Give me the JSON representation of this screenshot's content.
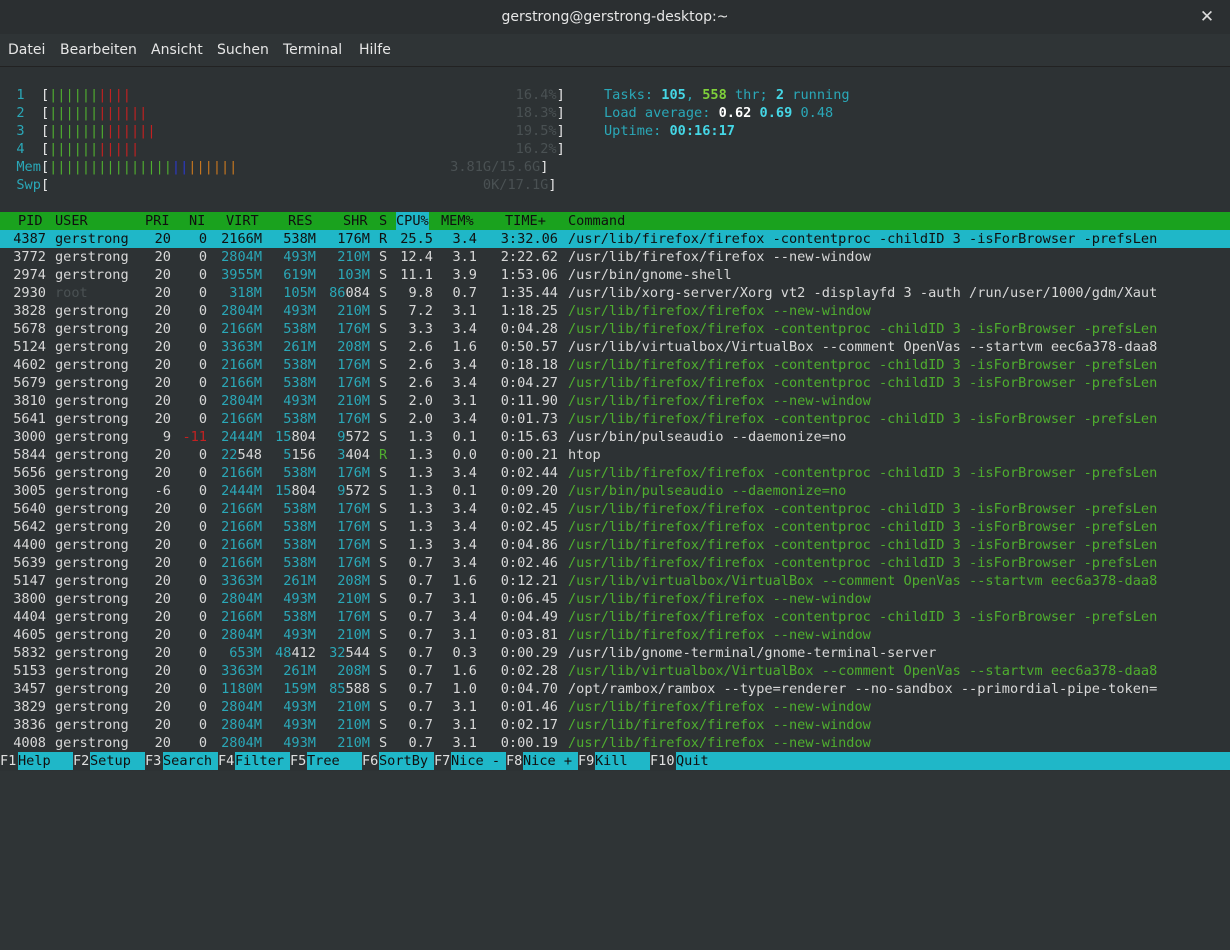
{
  "window": {
    "title": "gerstrong@gerstrong-desktop:~"
  },
  "menu": [
    "Datei",
    "Bearbeiten",
    "Ansicht",
    "Suchen",
    "Terminal",
    "Hilfe"
  ],
  "meters": {
    "cpu": [
      {
        "label": "1",
        "value": "16.4%"
      },
      {
        "label": "2",
        "value": "18.3%"
      },
      {
        "label": "3",
        "value": "19.5%"
      },
      {
        "label": "4",
        "value": "16.2%"
      }
    ],
    "mem": {
      "label": "Mem",
      "value": "3.81G/15.6G"
    },
    "swp": {
      "label": "Swp",
      "value": "0K/17.1G"
    }
  },
  "summary": {
    "tasks_label": "Tasks:",
    "tasks": "105",
    "threads": "558",
    "thr_label": "thr;",
    "running": "2",
    "running_label": "running",
    "load_label": "Load average:",
    "load1": "0.62",
    "load5": "0.69",
    "load15": "0.48",
    "uptime_label": "Uptime:",
    "uptime": "00:16:17"
  },
  "columns": [
    "PID",
    "USER",
    "PRI",
    "NI",
    "VIRT",
    "RES",
    "SHR",
    "S",
    "CPU%",
    "MEM%",
    "TIME+",
    "Command"
  ],
  "processes": [
    {
      "pid": "4387",
      "user": "gerstrong",
      "pri": "20",
      "ni": "0",
      "virt": "2166M",
      "res": "538M",
      "shr": "176M",
      "s": "R",
      "cpu": "25.5",
      "mem": "3.4",
      "time": "3:32.06",
      "cmd": "/usr/lib/firefox/firefox -contentproc -childID 3 -isForBrowser -prefsLen",
      "selected": true,
      "thread": false
    },
    {
      "pid": "3772",
      "user": "gerstrong",
      "pri": "20",
      "ni": "0",
      "virt": "2804M",
      "res": "493M",
      "shr": "210M",
      "s": "S",
      "cpu": "12.4",
      "mem": "3.1",
      "time": "2:22.62",
      "cmd": "/usr/lib/firefox/firefox --new-window",
      "selected": false,
      "thread": false
    },
    {
      "pid": "2974",
      "user": "gerstrong",
      "pri": "20",
      "ni": "0",
      "virt": "3955M",
      "res": "619M",
      "shr": "103M",
      "s": "S",
      "cpu": "11.1",
      "mem": "3.9",
      "time": "1:53.06",
      "cmd": "/usr/bin/gnome-shell",
      "selected": false,
      "thread": false
    },
    {
      "pid": "2930",
      "user": "root",
      "pri": "20",
      "ni": "0",
      "virt": "318M",
      "res": "105M",
      "shr": "86084",
      "s": "S",
      "cpu": "9.8",
      "mem": "0.7",
      "time": "1:35.44",
      "cmd": "/usr/lib/xorg-server/Xorg vt2 -displayfd 3 -auth /run/user/1000/gdm/Xaut",
      "selected": false,
      "thread": false
    },
    {
      "pid": "3828",
      "user": "gerstrong",
      "pri": "20",
      "ni": "0",
      "virt": "2804M",
      "res": "493M",
      "shr": "210M",
      "s": "S",
      "cpu": "7.2",
      "mem": "3.1",
      "time": "1:18.25",
      "cmd": "/usr/lib/firefox/firefox --new-window",
      "selected": false,
      "thread": true
    },
    {
      "pid": "5678",
      "user": "gerstrong",
      "pri": "20",
      "ni": "0",
      "virt": "2166M",
      "res": "538M",
      "shr": "176M",
      "s": "S",
      "cpu": "3.3",
      "mem": "3.4",
      "time": "0:04.28",
      "cmd": "/usr/lib/firefox/firefox -contentproc -childID 3 -isForBrowser -prefsLen",
      "selected": false,
      "thread": true
    },
    {
      "pid": "5124",
      "user": "gerstrong",
      "pri": "20",
      "ni": "0",
      "virt": "3363M",
      "res": "261M",
      "shr": "208M",
      "s": "S",
      "cpu": "2.6",
      "mem": "1.6",
      "time": "0:50.57",
      "cmd": "/usr/lib/virtualbox/VirtualBox --comment OpenVas --startvm eec6a378-daa8",
      "selected": false,
      "thread": false
    },
    {
      "pid": "4602",
      "user": "gerstrong",
      "pri": "20",
      "ni": "0",
      "virt": "2166M",
      "res": "538M",
      "shr": "176M",
      "s": "S",
      "cpu": "2.6",
      "mem": "3.4",
      "time": "0:18.18",
      "cmd": "/usr/lib/firefox/firefox -contentproc -childID 3 -isForBrowser -prefsLen",
      "selected": false,
      "thread": true
    },
    {
      "pid": "5679",
      "user": "gerstrong",
      "pri": "20",
      "ni": "0",
      "virt": "2166M",
      "res": "538M",
      "shr": "176M",
      "s": "S",
      "cpu": "2.6",
      "mem": "3.4",
      "time": "0:04.27",
      "cmd": "/usr/lib/firefox/firefox -contentproc -childID 3 -isForBrowser -prefsLen",
      "selected": false,
      "thread": true
    },
    {
      "pid": "3810",
      "user": "gerstrong",
      "pri": "20",
      "ni": "0",
      "virt": "2804M",
      "res": "493M",
      "shr": "210M",
      "s": "S",
      "cpu": "2.0",
      "mem": "3.1",
      "time": "0:11.90",
      "cmd": "/usr/lib/firefox/firefox --new-window",
      "selected": false,
      "thread": true
    },
    {
      "pid": "5641",
      "user": "gerstrong",
      "pri": "20",
      "ni": "0",
      "virt": "2166M",
      "res": "538M",
      "shr": "176M",
      "s": "S",
      "cpu": "2.0",
      "mem": "3.4",
      "time": "0:01.73",
      "cmd": "/usr/lib/firefox/firefox -contentproc -childID 3 -isForBrowser -prefsLen",
      "selected": false,
      "thread": true
    },
    {
      "pid": "3000",
      "user": "gerstrong",
      "pri": "9",
      "ni": "-11",
      "virt": "2444M",
      "res": "15804",
      "shr": "9572",
      "s": "S",
      "cpu": "1.3",
      "mem": "0.1",
      "time": "0:15.63",
      "cmd": "/usr/bin/pulseaudio --daemonize=no",
      "selected": false,
      "thread": false
    },
    {
      "pid": "5844",
      "user": "gerstrong",
      "pri": "20",
      "ni": "0",
      "virt": "22548",
      "res": "5156",
      "shr": "3404",
      "s": "R",
      "cpu": "1.3",
      "mem": "0.0",
      "time": "0:00.21",
      "cmd": "htop",
      "selected": false,
      "thread": false
    },
    {
      "pid": "5656",
      "user": "gerstrong",
      "pri": "20",
      "ni": "0",
      "virt": "2166M",
      "res": "538M",
      "shr": "176M",
      "s": "S",
      "cpu": "1.3",
      "mem": "3.4",
      "time": "0:02.44",
      "cmd": "/usr/lib/firefox/firefox -contentproc -childID 3 -isForBrowser -prefsLen",
      "selected": false,
      "thread": true
    },
    {
      "pid": "3005",
      "user": "gerstrong",
      "pri": "-6",
      "ni": "0",
      "virt": "2444M",
      "res": "15804",
      "shr": "9572",
      "s": "S",
      "cpu": "1.3",
      "mem": "0.1",
      "time": "0:09.20",
      "cmd": "/usr/bin/pulseaudio --daemonize=no",
      "selected": false,
      "thread": true
    },
    {
      "pid": "5640",
      "user": "gerstrong",
      "pri": "20",
      "ni": "0",
      "virt": "2166M",
      "res": "538M",
      "shr": "176M",
      "s": "S",
      "cpu": "1.3",
      "mem": "3.4",
      "time": "0:02.45",
      "cmd": "/usr/lib/firefox/firefox -contentproc -childID 3 -isForBrowser -prefsLen",
      "selected": false,
      "thread": true
    },
    {
      "pid": "5642",
      "user": "gerstrong",
      "pri": "20",
      "ni": "0",
      "virt": "2166M",
      "res": "538M",
      "shr": "176M",
      "s": "S",
      "cpu": "1.3",
      "mem": "3.4",
      "time": "0:02.45",
      "cmd": "/usr/lib/firefox/firefox -contentproc -childID 3 -isForBrowser -prefsLen",
      "selected": false,
      "thread": true
    },
    {
      "pid": "4400",
      "user": "gerstrong",
      "pri": "20",
      "ni": "0",
      "virt": "2166M",
      "res": "538M",
      "shr": "176M",
      "s": "S",
      "cpu": "1.3",
      "mem": "3.4",
      "time": "0:04.86",
      "cmd": "/usr/lib/firefox/firefox -contentproc -childID 3 -isForBrowser -prefsLen",
      "selected": false,
      "thread": true
    },
    {
      "pid": "5639",
      "user": "gerstrong",
      "pri": "20",
      "ni": "0",
      "virt": "2166M",
      "res": "538M",
      "shr": "176M",
      "s": "S",
      "cpu": "0.7",
      "mem": "3.4",
      "time": "0:02.46",
      "cmd": "/usr/lib/firefox/firefox -contentproc -childID 3 -isForBrowser -prefsLen",
      "selected": false,
      "thread": true
    },
    {
      "pid": "5147",
      "user": "gerstrong",
      "pri": "20",
      "ni": "0",
      "virt": "3363M",
      "res": "261M",
      "shr": "208M",
      "s": "S",
      "cpu": "0.7",
      "mem": "1.6",
      "time": "0:12.21",
      "cmd": "/usr/lib/virtualbox/VirtualBox --comment OpenVas --startvm eec6a378-daa8",
      "selected": false,
      "thread": true
    },
    {
      "pid": "3800",
      "user": "gerstrong",
      "pri": "20",
      "ni": "0",
      "virt": "2804M",
      "res": "493M",
      "shr": "210M",
      "s": "S",
      "cpu": "0.7",
      "mem": "3.1",
      "time": "0:06.45",
      "cmd": "/usr/lib/firefox/firefox --new-window",
      "selected": false,
      "thread": true
    },
    {
      "pid": "4404",
      "user": "gerstrong",
      "pri": "20",
      "ni": "0",
      "virt": "2166M",
      "res": "538M",
      "shr": "176M",
      "s": "S",
      "cpu": "0.7",
      "mem": "3.4",
      "time": "0:04.49",
      "cmd": "/usr/lib/firefox/firefox -contentproc -childID 3 -isForBrowser -prefsLen",
      "selected": false,
      "thread": true
    },
    {
      "pid": "4605",
      "user": "gerstrong",
      "pri": "20",
      "ni": "0",
      "virt": "2804M",
      "res": "493M",
      "shr": "210M",
      "s": "S",
      "cpu": "0.7",
      "mem": "3.1",
      "time": "0:03.81",
      "cmd": "/usr/lib/firefox/firefox --new-window",
      "selected": false,
      "thread": true
    },
    {
      "pid": "5832",
      "user": "gerstrong",
      "pri": "20",
      "ni": "0",
      "virt": "653M",
      "res": "48412",
      "shr": "32544",
      "s": "S",
      "cpu": "0.7",
      "mem": "0.3",
      "time": "0:00.29",
      "cmd": "/usr/lib/gnome-terminal/gnome-terminal-server",
      "selected": false,
      "thread": false
    },
    {
      "pid": "5153",
      "user": "gerstrong",
      "pri": "20",
      "ni": "0",
      "virt": "3363M",
      "res": "261M",
      "shr": "208M",
      "s": "S",
      "cpu": "0.7",
      "mem": "1.6",
      "time": "0:02.28",
      "cmd": "/usr/lib/virtualbox/VirtualBox --comment OpenVas --startvm eec6a378-daa8",
      "selected": false,
      "thread": true
    },
    {
      "pid": "3457",
      "user": "gerstrong",
      "pri": "20",
      "ni": "0",
      "virt": "1180M",
      "res": "159M",
      "shr": "85588",
      "s": "S",
      "cpu": "0.7",
      "mem": "1.0",
      "time": "0:04.70",
      "cmd": "/opt/rambox/rambox --type=renderer --no-sandbox --primordial-pipe-token=",
      "selected": false,
      "thread": false
    },
    {
      "pid": "3829",
      "user": "gerstrong",
      "pri": "20",
      "ni": "0",
      "virt": "2804M",
      "res": "493M",
      "shr": "210M",
      "s": "S",
      "cpu": "0.7",
      "mem": "3.1",
      "time": "0:01.46",
      "cmd": "/usr/lib/firefox/firefox --new-window",
      "selected": false,
      "thread": true
    },
    {
      "pid": "3836",
      "user": "gerstrong",
      "pri": "20",
      "ni": "0",
      "virt": "2804M",
      "res": "493M",
      "shr": "210M",
      "s": "S",
      "cpu": "0.7",
      "mem": "3.1",
      "time": "0:02.17",
      "cmd": "/usr/lib/firefox/firefox --new-window",
      "selected": false,
      "thread": true
    },
    {
      "pid": "4008",
      "user": "gerstrong",
      "pri": "20",
      "ni": "0",
      "virt": "2804M",
      "res": "493M",
      "shr": "210M",
      "s": "S",
      "cpu": "0.7",
      "mem": "3.1",
      "time": "0:00.19",
      "cmd": "/usr/lib/firefox/firefox --new-window",
      "selected": false,
      "thread": true
    }
  ],
  "function_keys": [
    {
      "key": "F1",
      "label": "Help"
    },
    {
      "key": "F2",
      "label": "Setup"
    },
    {
      "key": "F3",
      "label": "Search"
    },
    {
      "key": "F4",
      "label": "Filter"
    },
    {
      "key": "F5",
      "label": "Tree"
    },
    {
      "key": "F6",
      "label": "SortBy"
    },
    {
      "key": "F7",
      "label": "Nice -"
    },
    {
      "key": "F8",
      "label": "Nice +"
    },
    {
      "key": "F9",
      "label": "Kill"
    },
    {
      "key": "F10",
      "label": "Quit"
    }
  ],
  "colors": {
    "accent_cyan": "#1fb7c8",
    "header_green": "#1aa21e",
    "thread_green": "#4fae2f",
    "nice_red": "#c32121"
  }
}
